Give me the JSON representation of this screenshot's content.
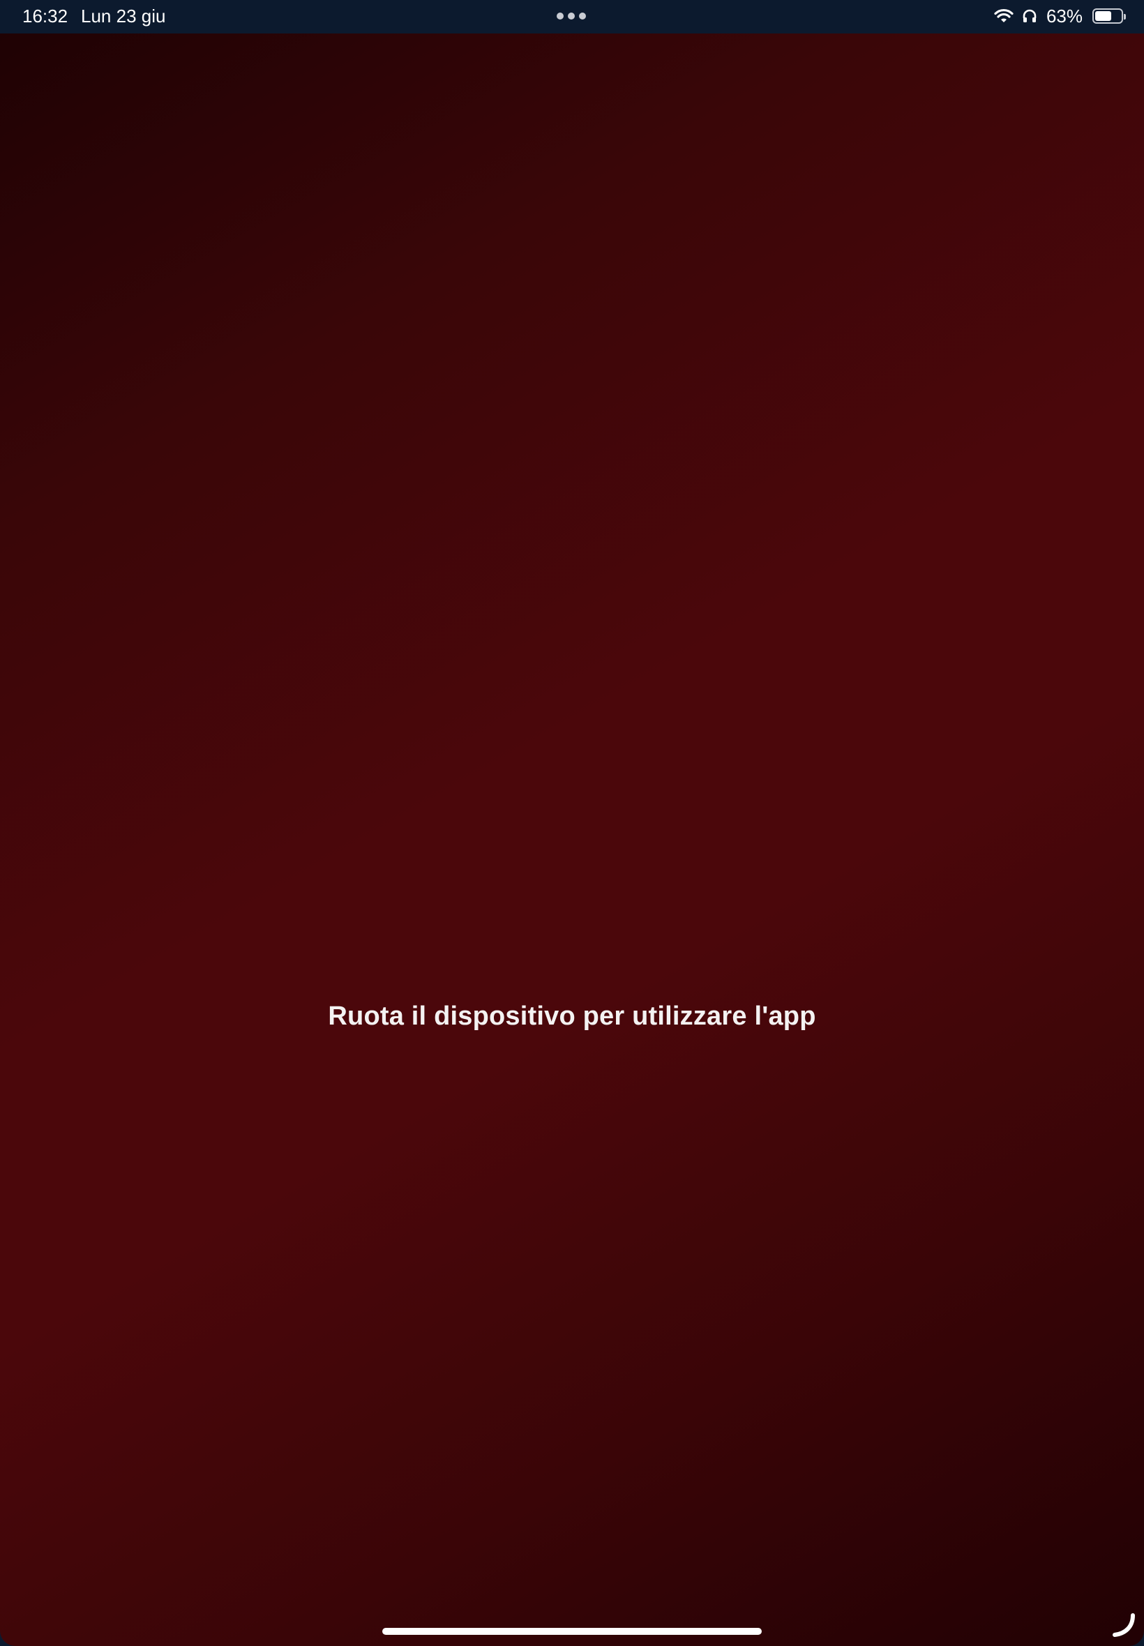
{
  "status_bar": {
    "time": "16:32",
    "date": "Lun 23 giu",
    "battery_percent": "63%",
    "battery_level": 0.63,
    "icons": [
      "wifi-icon",
      "headphones-icon",
      "battery-icon"
    ]
  },
  "multitasking": {
    "icon": "multitask-dots-icon"
  },
  "main": {
    "message": "Ruota il dispositivo per utilizzare l'app"
  },
  "window": {
    "resize_icon": "resize-handle-icon"
  },
  "colors": {
    "status_bar_bg": "#0c1a2e",
    "background_dark": "#1f0204",
    "background_mid": "#4b070b",
    "text": "#f4f2f2"
  }
}
